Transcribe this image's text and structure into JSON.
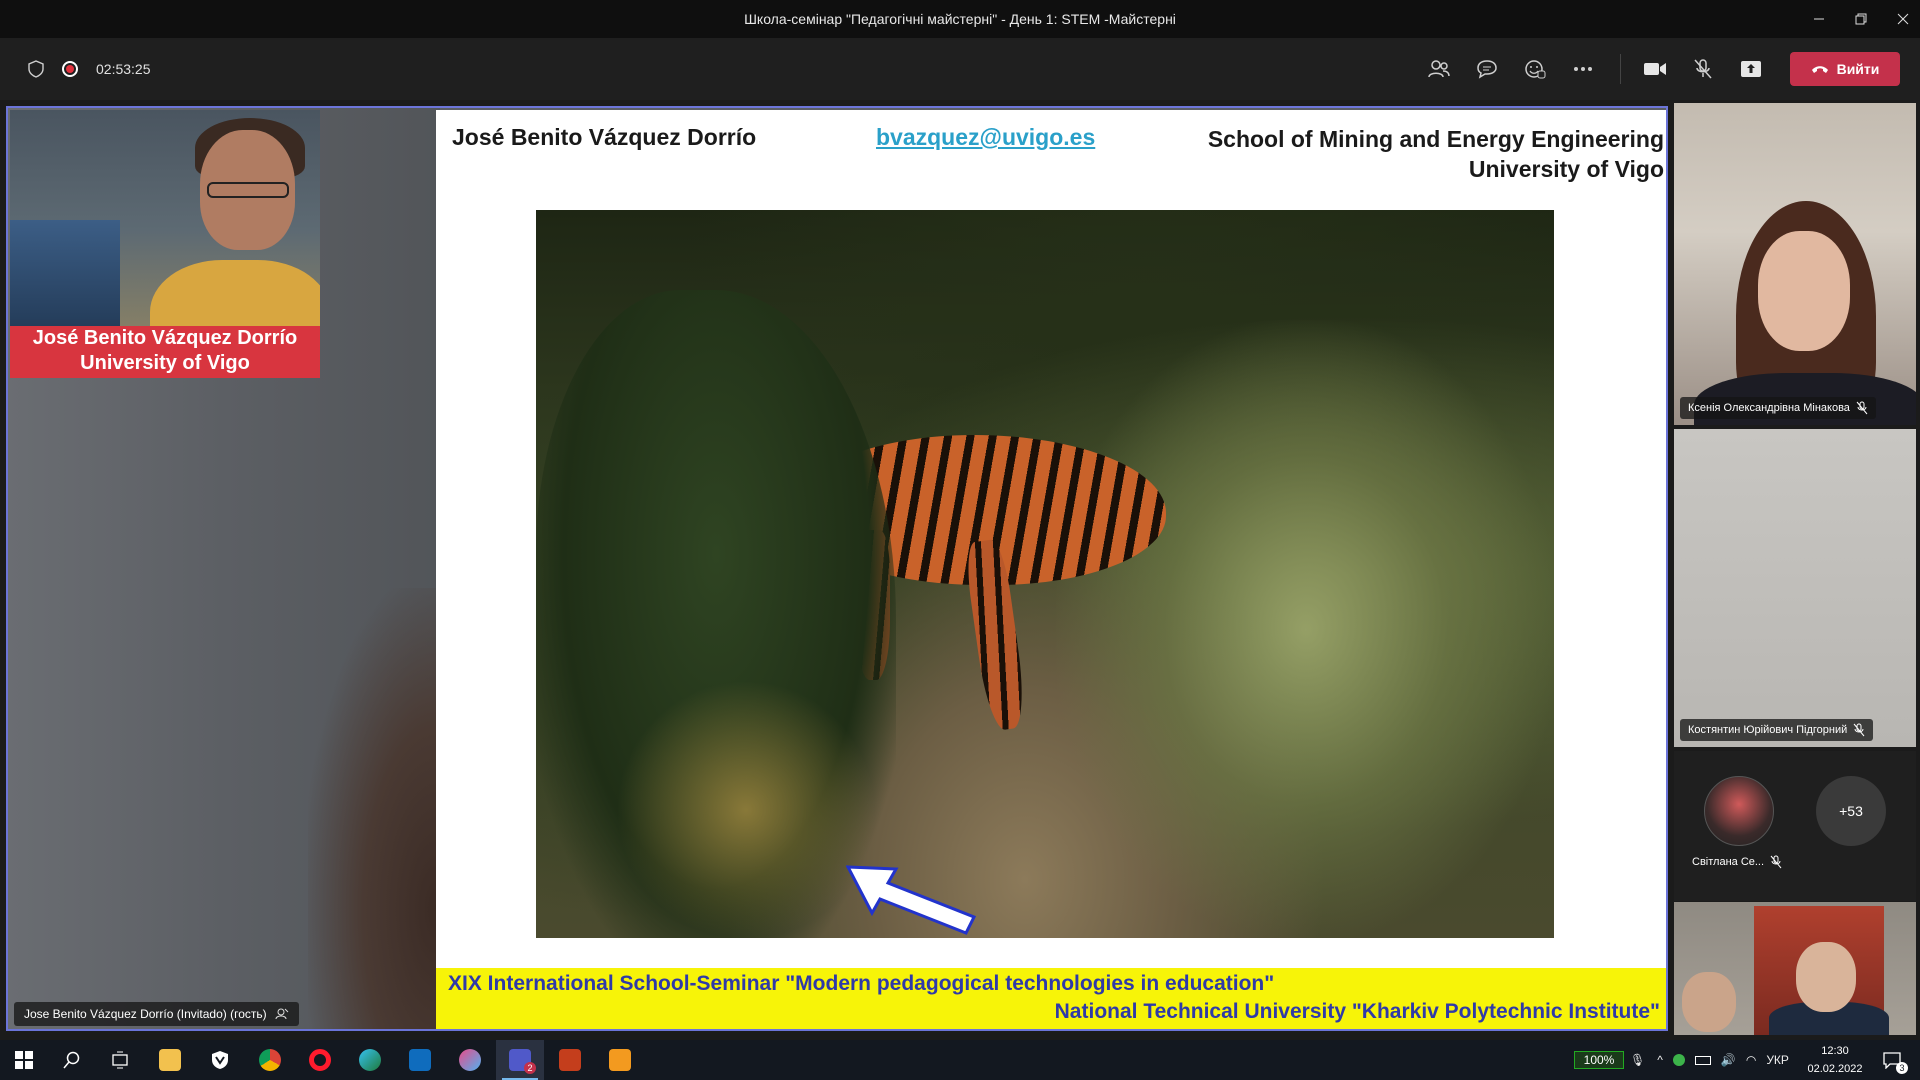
{
  "window": {
    "title": "Школа-семінар \"Педагогічні майстерні\" - День 1: STEM -Майстерні",
    "minimize_icon": "minimize-icon",
    "restore_icon": "restore-icon",
    "close_icon": "close-icon"
  },
  "meeting_toolbar": {
    "timer": "02:53:25",
    "leave_label": "Вийти",
    "colors": {
      "leave": "#c4314b",
      "recording": "#e0313d"
    }
  },
  "stage": {
    "speaker_label": "Jose Benito Vázquez Dorrío (Invitado) (гость)",
    "presenter_banner": {
      "line1": "José Benito Vázquez Dorrío",
      "line2": "University of  Vigo"
    },
    "slide": {
      "author": "José Benito Vázquez Dorrío",
      "email": "bvazquez@uvigo.es",
      "school_line1": "School of Mining and Energy Engineering",
      "school_line2": "University of Vigo",
      "footer_line1": "XIX International School-Seminar \"Modern pedagogical technologies in education\"",
      "footer_line2": "National Technical University \"Kharkiv Polytechnic Institute\""
    }
  },
  "participants": {
    "tile1": {
      "name": "Ксенія Олександрівна Мінакова"
    },
    "tile2": {
      "name": "Костянтин Юрійович Підгорний"
    },
    "tile3": {
      "name": "Світлана Се...",
      "more_count": "+53"
    }
  },
  "taskbar": {
    "teams_badge": "2",
    "zoom_level": "100%",
    "language": "УКР",
    "time": "12:30",
    "date": "02.02.2022",
    "notification_count": "3"
  }
}
